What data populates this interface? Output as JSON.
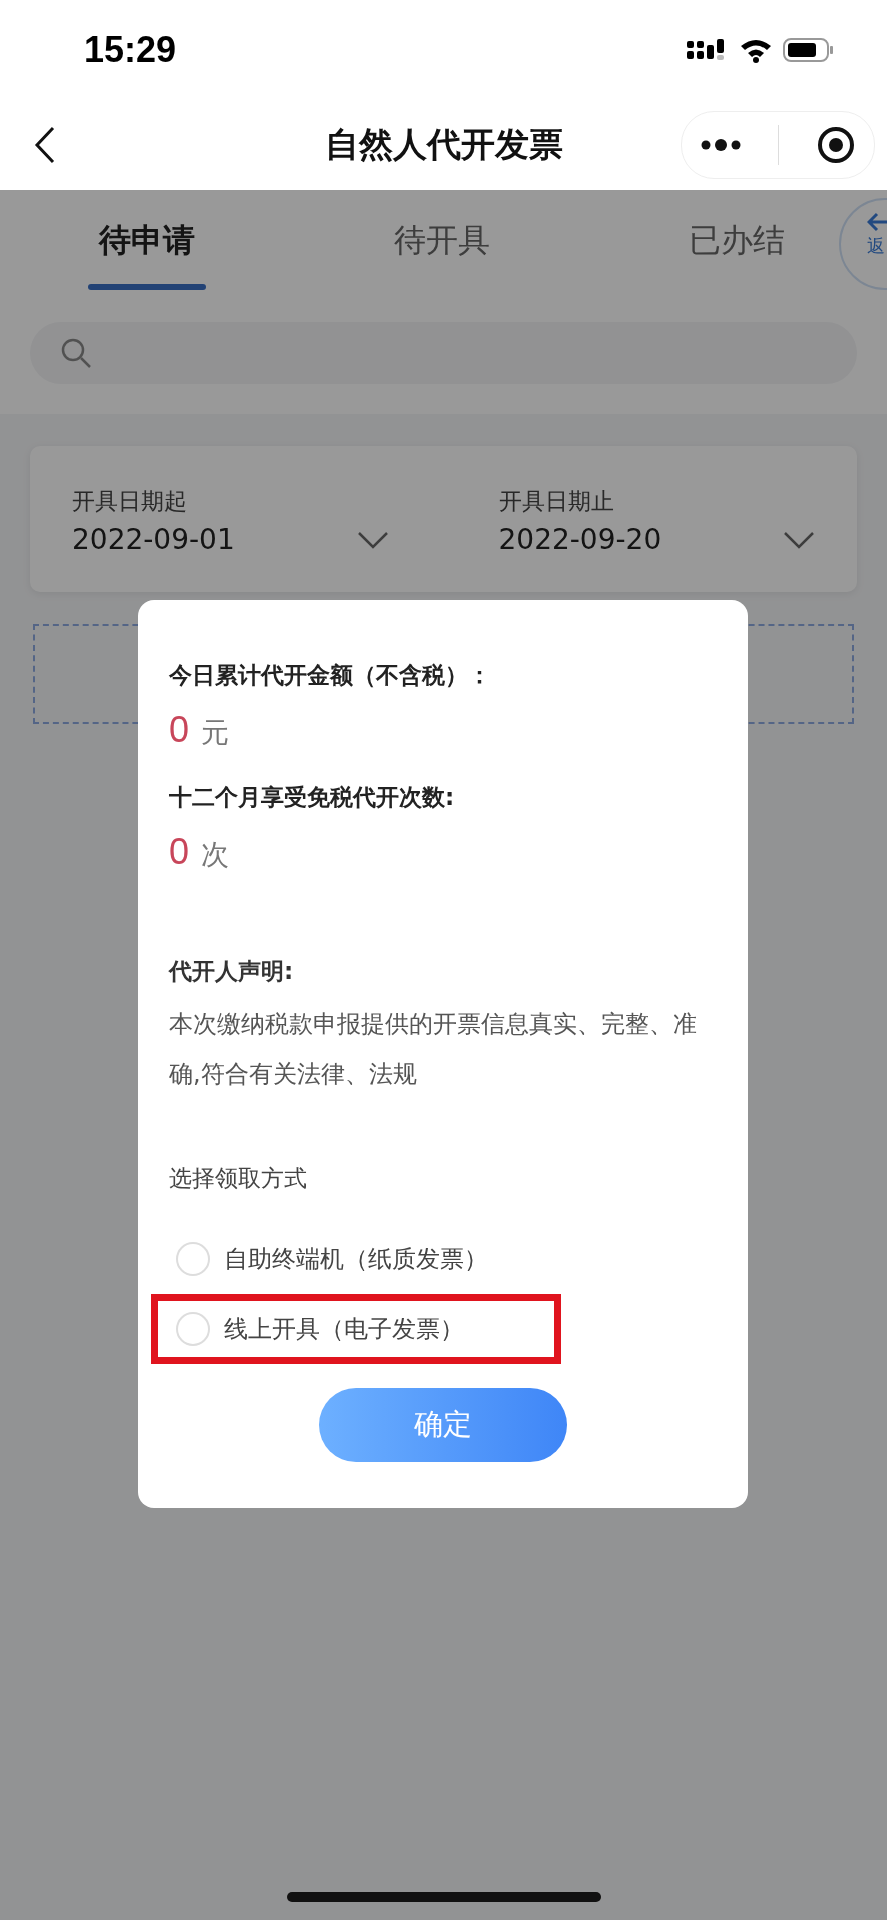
{
  "status_bar": {
    "time": "15:29"
  },
  "nav": {
    "title": "自然人代开发票"
  },
  "tabs": [
    {
      "label": "待申请",
      "selected": true
    },
    {
      "label": "待开具",
      "selected": false
    },
    {
      "label": "已办结",
      "selected": false
    }
  ],
  "float_button": {
    "label": "返"
  },
  "date_filter": [
    {
      "label": "开具日期起",
      "value": "2022-09-01"
    },
    {
      "label": "开具日期止",
      "value": "2022-09-20"
    }
  ],
  "dialog": {
    "stats": [
      {
        "label": "今日累计代开金额（不含税）：",
        "value": "0",
        "unit": "元"
      },
      {
        "label": "十二个月享受免税代开次数:",
        "value": "0",
        "unit": "次"
      }
    ],
    "declaration_title": "代开人声明:",
    "declaration_text": "本次缴纳税款申报提供的开票信息真实、完整、准确,符合有关法律、法规",
    "choice_title": "选择领取方式",
    "options": [
      {
        "label": "自助终端机（纸质发票）",
        "selected": false,
        "highlighted": false
      },
      {
        "label": "线上开具（电子发票）",
        "selected": false,
        "highlighted": true
      }
    ],
    "confirm": "确定"
  }
}
